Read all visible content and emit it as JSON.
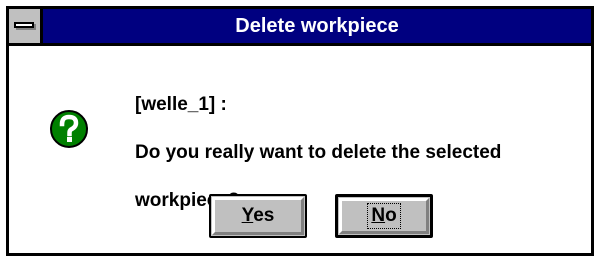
{
  "window": {
    "title": "Delete workpiece"
  },
  "message": {
    "line1": "[welle_1] :",
    "line2": "Do you really want to delete the selected",
    "line3": "workpiece?"
  },
  "icon": {
    "name": "question-icon",
    "color": "#008000"
  },
  "buttons": {
    "yes": {
      "mnemonic": "Y",
      "rest": "es"
    },
    "no": {
      "mnemonic": "N",
      "rest": "o"
    }
  },
  "colors": {
    "titlebar": "#000080",
    "button_face": "#c0c0c0"
  }
}
